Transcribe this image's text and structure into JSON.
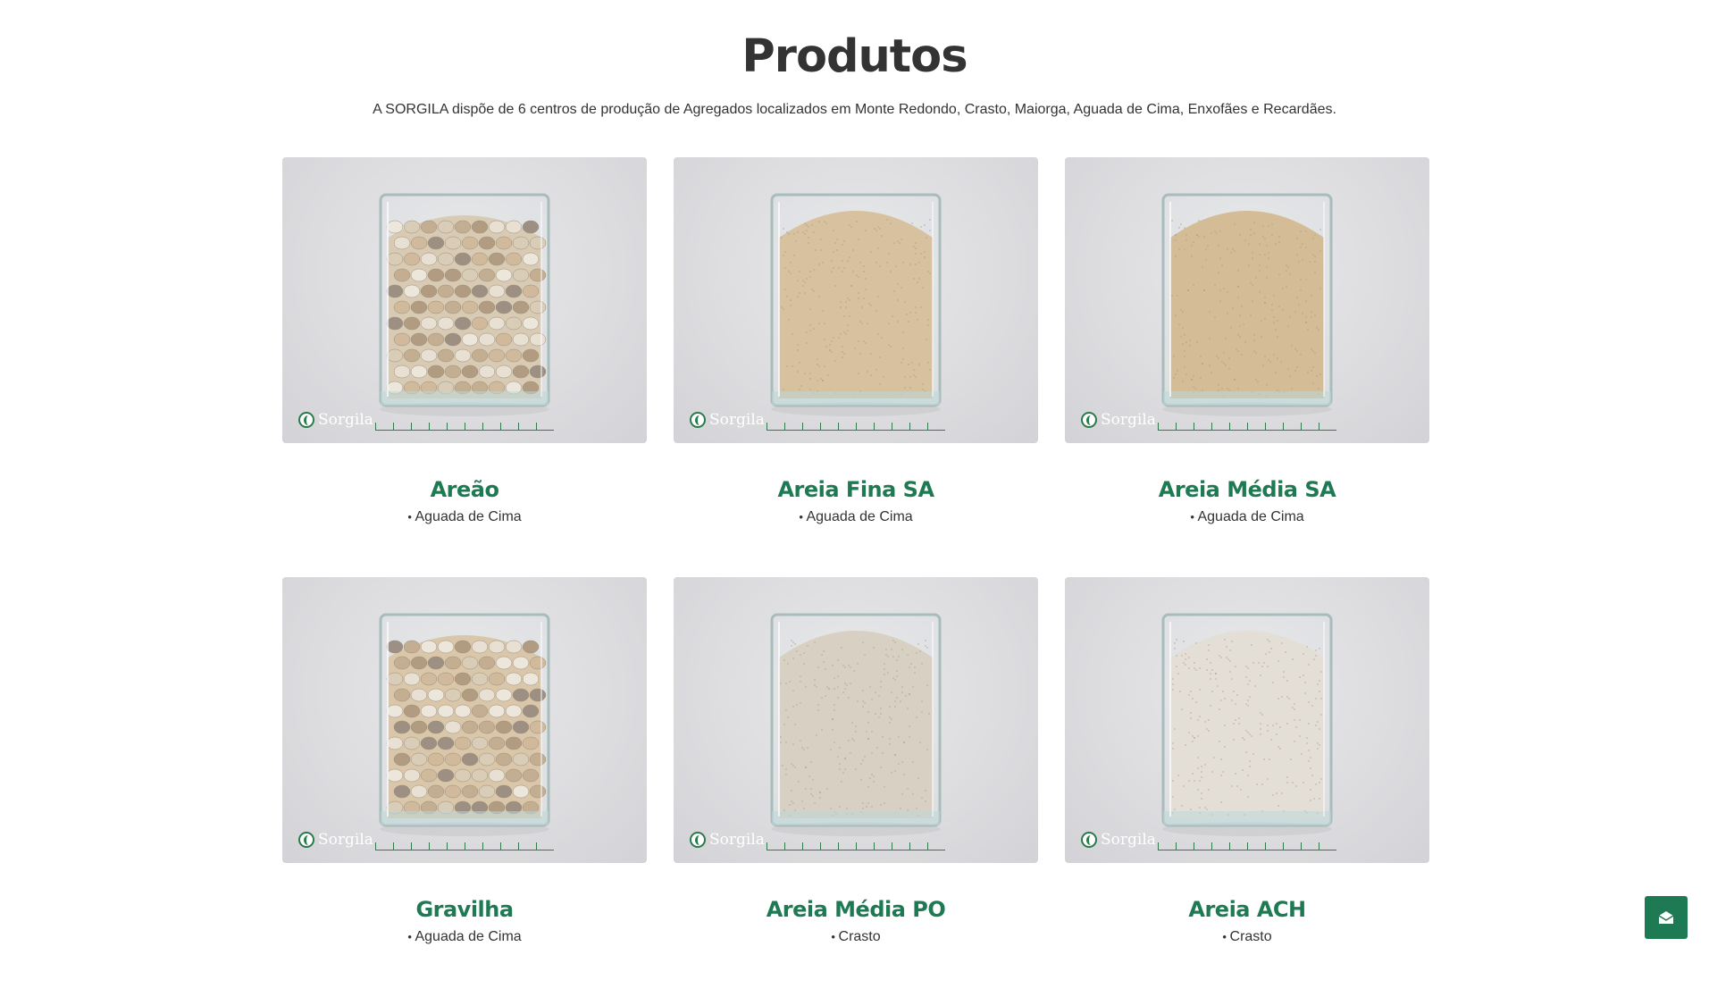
{
  "page": {
    "title": "Produtos",
    "intro": "A SORGILA dispõe de 6 centros de produção de Agregados localizados em Monte Redondo, Crasto, Maiorga, Aguada de Cima, Enxofães e Recardães.",
    "accent_color": "#1e7a52"
  },
  "products": [
    {
      "name": "Areão",
      "location": "Aguada de Cima",
      "material": "pebbles",
      "fill_color": "#d8c5a8",
      "brand": "Sorgila"
    },
    {
      "name": "Areia Fina SA",
      "location": "Aguada de Cima",
      "material": "sand",
      "fill_color": "#d6b98e",
      "brand": "Sorgila"
    },
    {
      "name": "Areia Média SA",
      "location": "Aguada de Cima",
      "material": "coarse-sand",
      "fill_color": "#d2b285",
      "brand": "Sorgila"
    },
    {
      "name": "Gravilha",
      "location": "Aguada de Cima",
      "material": "pebbles",
      "fill_color": "#d9bf9c",
      "brand": "Sorgila"
    },
    {
      "name": "Areia Média PO",
      "location": "Crasto",
      "material": "coarse-sand",
      "fill_color": "#d7cbbb",
      "brand": "Sorgila"
    },
    {
      "name": "Areia ACH",
      "location": "Crasto",
      "material": "fine-white-sand",
      "fill_color": "#e6ddd2",
      "brand": "Sorgila"
    }
  ],
  "contact_button": {
    "icon": "mail-open-icon"
  }
}
